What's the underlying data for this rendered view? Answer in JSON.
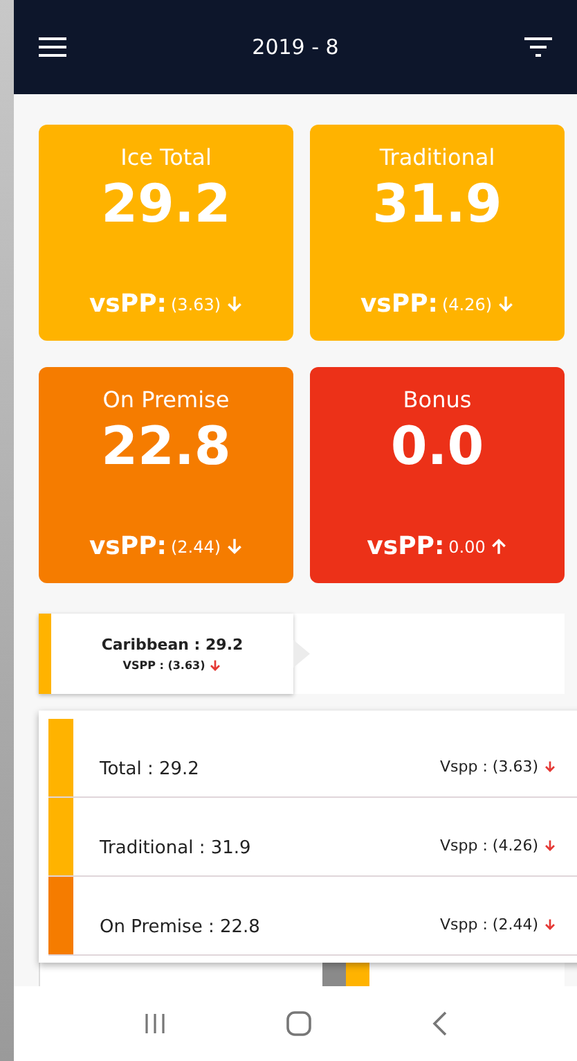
{
  "header": {
    "title": "2019 - 8"
  },
  "cards": [
    {
      "title": "Ice Total",
      "value": "29.2",
      "label": "vsPP:",
      "change": "(3.63)",
      "rising": false,
      "color": "#ffb300"
    },
    {
      "title": "Traditional",
      "value": "31.9",
      "label": "vsPP:",
      "change": "(4.26)",
      "rising": false,
      "color": "#ffb300"
    },
    {
      "title": "On Premise",
      "value": "22.8",
      "label": "vsPP:",
      "change": "(2.44)",
      "rising": false,
      "color": "#f57c00"
    },
    {
      "title": "Bonus",
      "value": "0.0",
      "label": "vsPP:",
      "change": "0.00",
      "rising": true,
      "color": "#ec3118"
    }
  ],
  "tooltip": {
    "title": "Caribbean : 29.2",
    "subtitle": "VSPP : (3.63)",
    "rising": false,
    "color": "#ffb300"
  },
  "breakdown": [
    {
      "name": "Total : 29.2",
      "vspp": "Vspp : (3.63)",
      "rising": false,
      "color": "#ffb300"
    },
    {
      "name": "Traditional : 31.9",
      "vspp": "Vspp : (4.26)",
      "rising": false,
      "color": "#ffb300"
    },
    {
      "name": "On Premise : 22.8",
      "vspp": "Vspp : (2.44)",
      "rising": false,
      "color": "#f57c00"
    }
  ]
}
